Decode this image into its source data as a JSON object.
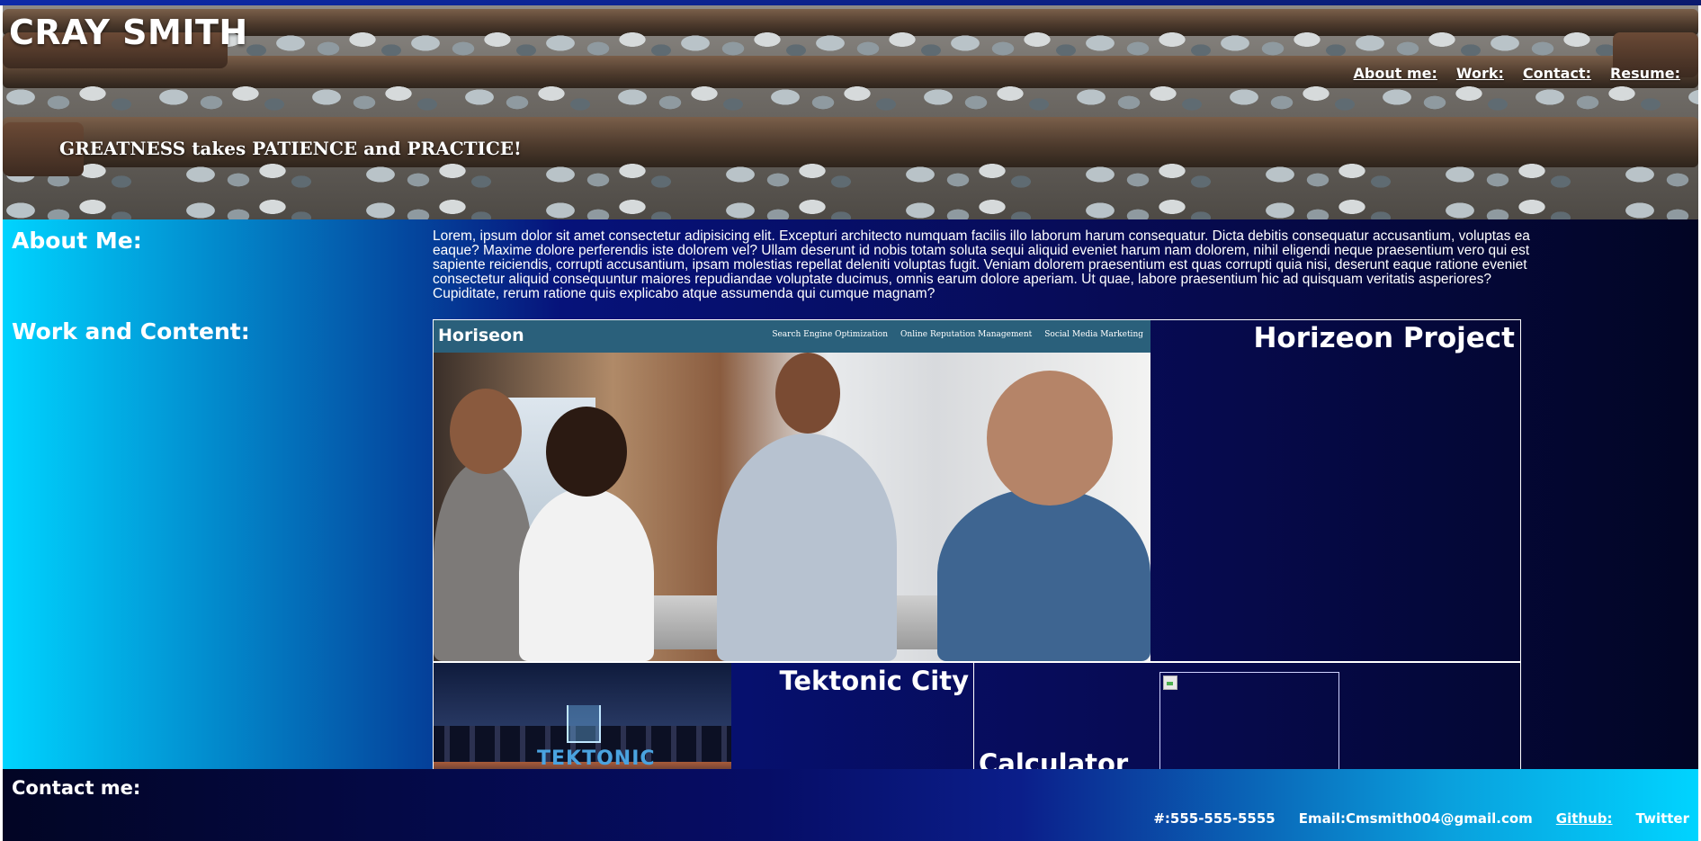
{
  "header": {
    "title": "CRAY SMITH",
    "tagline": "GREATNESS takes PATIENCE and PRACTICE!",
    "nav": [
      {
        "label": "About me:"
      },
      {
        "label": "Work:"
      },
      {
        "label": "Contact:"
      },
      {
        "label": "Resume:"
      }
    ]
  },
  "about": {
    "heading": "About Me:",
    "text": "Lorem, ipsum dolor sit amet consectetur adipisicing elit. Excepturi architecto numquam facilis illo laborum harum consequatur. Dicta debitis consequatur accusantium, voluptas ea eaque? Maxime dolore perferendis iste dolorem vel? Ullam deserunt id nobis totam soluta sequi aliquid eveniet harum nam dolorem, nihil eligendi neque praesentium vero qui est sapiente reiciendis, corrupti accusantium, ipsam molestias repellat deleniti voluptas fugit. Veniam dolorem praesentium est quas corrupti quia nisi, deserunt eaque ratione eveniet consectetur aliquid consequuntur maiores repudiandae voluptate ducimus, omnis earum dolore aperiam. Ut quae, labore praesentium hic ad quisquam veritatis asperiores? Cupiditate, rerum ratione quis explicabo atque assumenda qui cumque magnam?"
  },
  "work": {
    "heading": "Work and Content:",
    "projects": [
      {
        "title": "Horizeon Project",
        "screenshot": {
          "logo": "Horiseon",
          "links": [
            "Search Engine Optimization",
            "Online Reputation Management",
            "Social Media Marketing"
          ]
        }
      },
      {
        "title": "Tektonic City",
        "image_text": "TEKTONIC"
      },
      {
        "title": "Calculator",
        "image": "broken-image-icon"
      }
    ]
  },
  "contact": {
    "heading": "Contact me:",
    "phone": "#:555-555-5555",
    "email": "Email:Cmsmith004@gmail.com",
    "github": "Github:",
    "twitter": "Twitter"
  },
  "colors": {
    "gradient_left": "#00d4ff",
    "gradient_mid": "#06127a",
    "gradient_dark": "#020524",
    "text": "#ffffff"
  }
}
